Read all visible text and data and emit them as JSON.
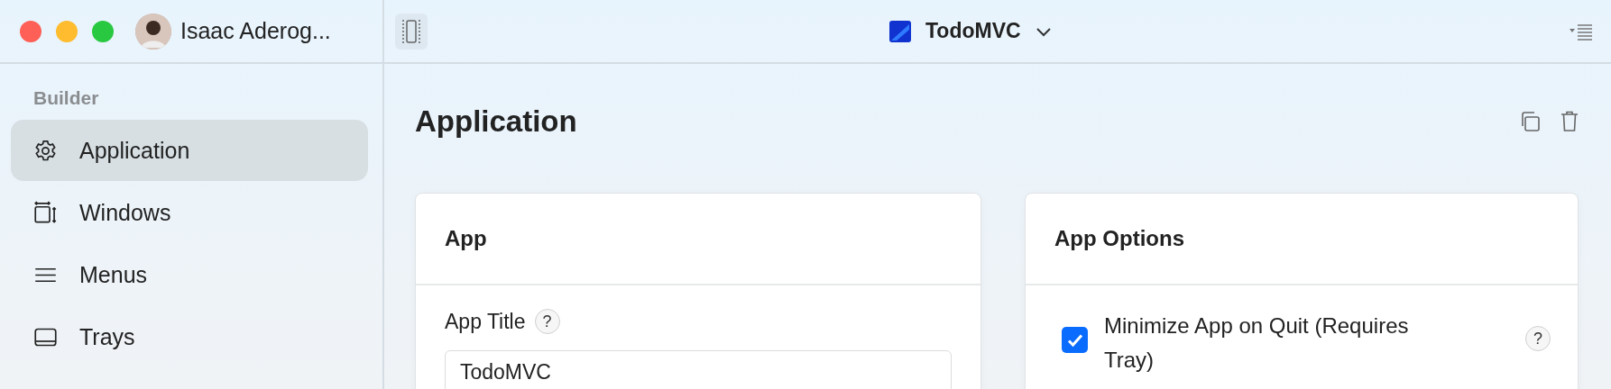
{
  "window": {
    "user_name": "Isaac Aderog...",
    "title": "TodoMVC"
  },
  "sidebar": {
    "section": "Builder",
    "items": [
      {
        "label": "Application",
        "kind": "gear",
        "selected": true
      },
      {
        "label": "Windows",
        "kind": "window",
        "selected": false
      },
      {
        "label": "Menus",
        "kind": "menu",
        "selected": false
      },
      {
        "label": "Trays",
        "kind": "tray",
        "selected": false
      }
    ]
  },
  "page": {
    "title": "Application"
  },
  "cards": [
    {
      "title": "App",
      "fields": [
        {
          "kind": "text",
          "label": "App Title",
          "help": "?",
          "value": "TodoMVC"
        }
      ]
    },
    {
      "title": "App Options",
      "fields": [
        {
          "kind": "checkbox",
          "label": "Minimize App on Quit (Requires Tray)",
          "help": "?",
          "checked": true
        }
      ]
    }
  ]
}
